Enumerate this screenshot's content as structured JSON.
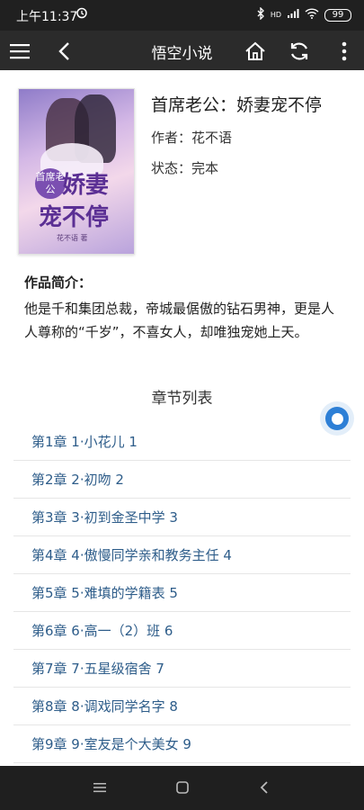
{
  "status_bar": {
    "time": "上午11:37",
    "alarm_icon": "alarm-icon",
    "network_label": "HD",
    "battery": "99"
  },
  "app_bar": {
    "title": "悟空小说",
    "icons": [
      "menu-icon",
      "back-icon",
      "home-icon",
      "refresh-icon",
      "more-icon"
    ]
  },
  "book": {
    "title": "首席老公：娇妻宠不停",
    "author_label": "作者：花不语",
    "status_label": "状态：完本",
    "cover": {
      "badge": "首席老公",
      "line1": "娇妻",
      "line2": "宠不停",
      "author": "花不语 著"
    }
  },
  "intro": {
    "heading": "作品简介：",
    "text": "他是千和集团总裁，帝城最倨傲的钻石男神，更是人人尊称的“千岁”，不喜女人，却唯独宠她上天。"
  },
  "chapters": {
    "heading": "章节列表",
    "items": [
      "第1章 1·小花儿 1",
      "第2章 2·初吻 2",
      "第3章 3·初到金圣中学 3",
      "第4章 4·傲慢同学亲和教务主任 4",
      "第5章 5·难填的学籍表 5",
      "第6章 6·高一（2）班 6",
      "第7章 7·五星级宿舍 7",
      "第8章 8·调戏同学名字 8",
      "第9章 9·室友是个大美女 9"
    ]
  },
  "colors": {
    "app_bar": "#2b2b2b",
    "chapter_link": "#2e5d8a",
    "float_button": "#2d7fd6"
  }
}
